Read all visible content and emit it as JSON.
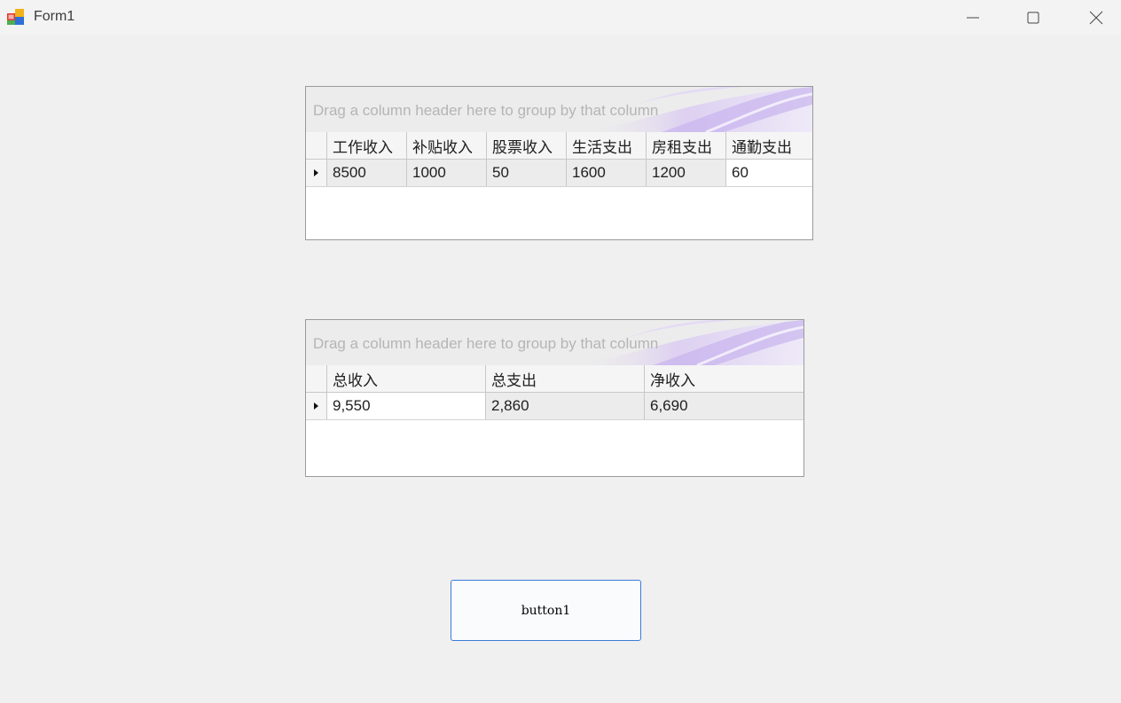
{
  "window": {
    "title": "Form1"
  },
  "grid1": {
    "group_panel_text": "Drag a column header here to group by that column",
    "columns": [
      "工作收入",
      "补贴收入",
      "股票收入",
      "生活支出",
      "房租支出",
      "通勤支出"
    ],
    "rows": [
      [
        "8500",
        "1000",
        "50",
        "1600",
        "1200",
        "60"
      ]
    ]
  },
  "grid2": {
    "group_panel_text": "Drag a column header here to group by that column",
    "columns": [
      "总收入",
      "总支出",
      "净收入"
    ],
    "rows": [
      [
        "9,550",
        "2,860",
        "6,690"
      ]
    ]
  },
  "button1": {
    "label": "button1"
  },
  "colors": {
    "button_border": "#3a7bd5",
    "group_panel_decoration": "#c8b4ec"
  }
}
